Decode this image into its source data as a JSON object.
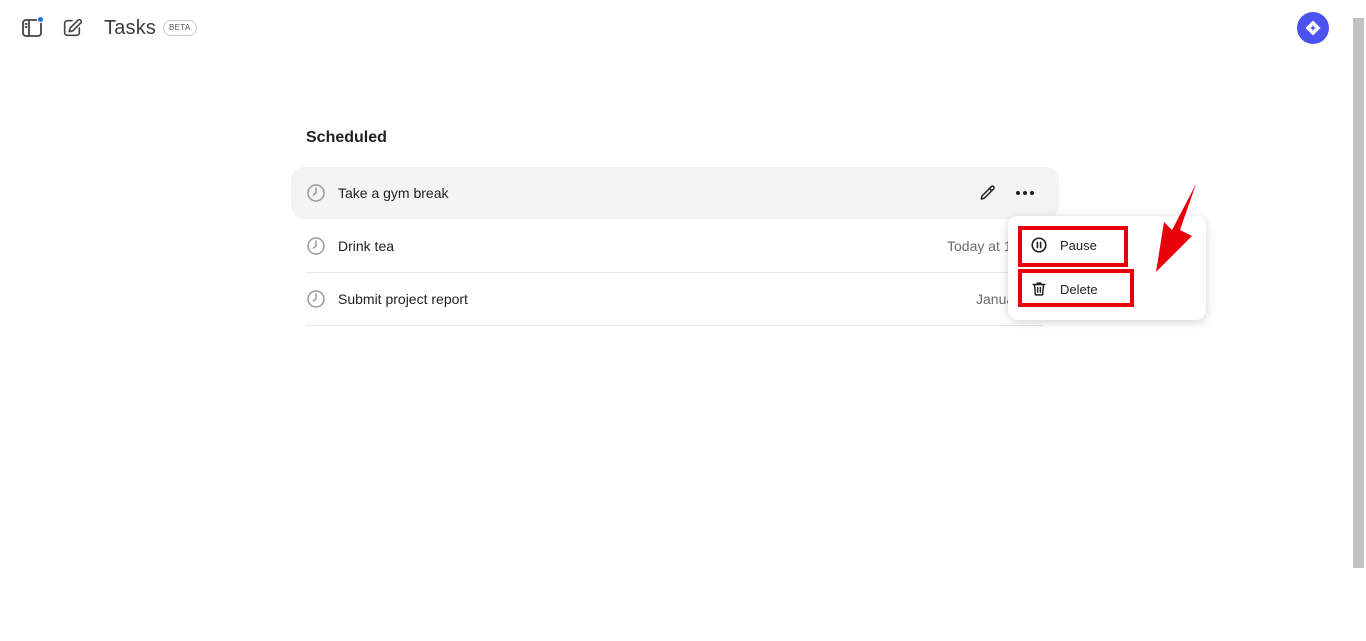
{
  "header": {
    "title": "Tasks",
    "badge": "BETA"
  },
  "section": {
    "title": "Scheduled"
  },
  "tasks": [
    {
      "name": "Take a gym break",
      "time": ""
    },
    {
      "name": "Drink tea",
      "time": "Today at 1"
    },
    {
      "name": "Submit project report",
      "time": "Janua"
    }
  ],
  "menu": {
    "items": [
      {
        "label": "Pause",
        "icon": "pause-circle-icon"
      },
      {
        "label": "Delete",
        "icon": "trash-icon"
      }
    ]
  },
  "colors": {
    "accent": "#4b52f0",
    "notification": "#1a73e8",
    "annotation": "#e8000b"
  }
}
